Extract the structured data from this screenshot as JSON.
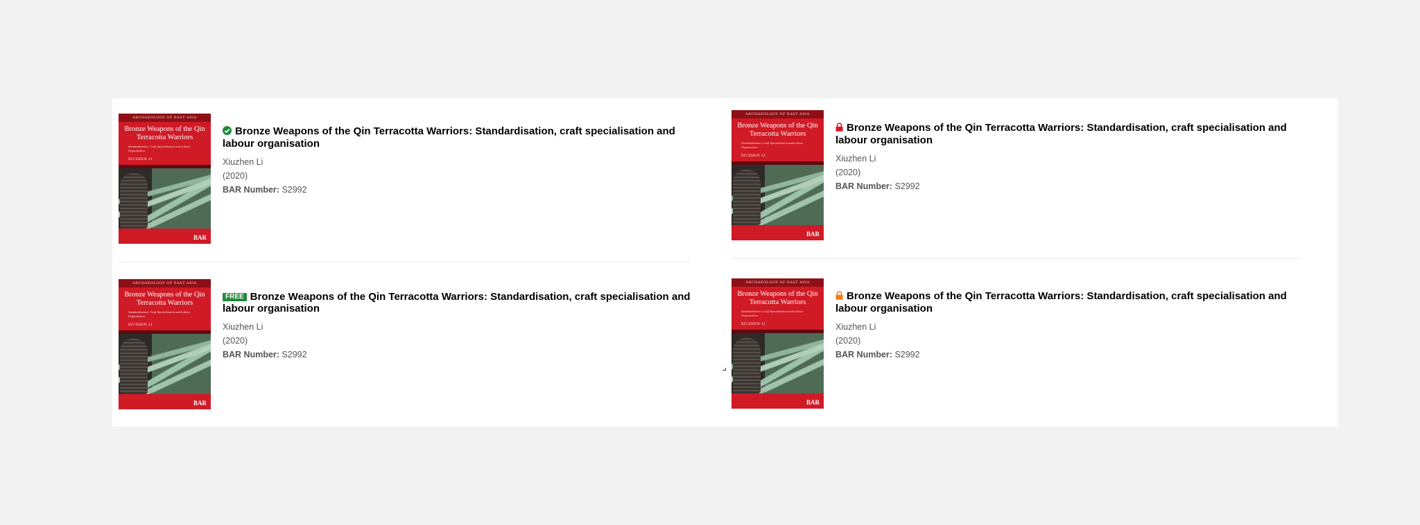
{
  "results": [
    {
      "status": "full-access",
      "status_icon": "check-circle-icon",
      "title": "Bronze Weapons of the Qin Terracotta Warriors: Standardisation, craft specialisation and labour organisation",
      "author": "Xiuzhen Li",
      "year": "(2020)",
      "bar_label": "BAR Number:",
      "bar_number": "S2992"
    },
    {
      "status": "locked",
      "status_icon": "lock-red-icon",
      "title": "Bronze Weapons of the Qin Terracotta Warriors: Standardisation, craft specialisation and labour organisation",
      "author": "Xiuzhen Li",
      "year": "(2020)",
      "bar_label": "BAR Number:",
      "bar_number": "S2992"
    },
    {
      "status": "free",
      "badge": "FREE",
      "title": "Bronze Weapons of the Qin Terracotta Warriors: Standardisation, craft specialisation and labour organisation",
      "author": "Xiuzhen Li",
      "year": "(2020)",
      "bar_label": "BAR Number:",
      "bar_number": "S2992"
    },
    {
      "status": "partial-access",
      "status_icon": "lock-orange-icon",
      "title": "Bronze Weapons of the Qin Terracotta Warriors: Standardisation, craft specialisation and labour organisation",
      "author": "Xiuzhen Li",
      "year": "(2020)",
      "bar_label": "BAR Number:",
      "bar_number": "S2992"
    }
  ],
  "cover": {
    "series": "ARCHAEOLOGY OF EAST ASIA",
    "title": "Bronze Weapons of the Qin Terracotta Warriors",
    "subtitle": "Standardisation, Craft Specialisation and Labour Organisation",
    "author": "XIUZHEN LI",
    "logo": "BAR"
  },
  "colors": {
    "page_background": "#f2f2f2",
    "panel_background": "#ffffff",
    "cover_red": "#d01a26",
    "access_green": "#1f8a3b",
    "lock_red": "#d8182a",
    "lock_orange": "#f07d12"
  }
}
